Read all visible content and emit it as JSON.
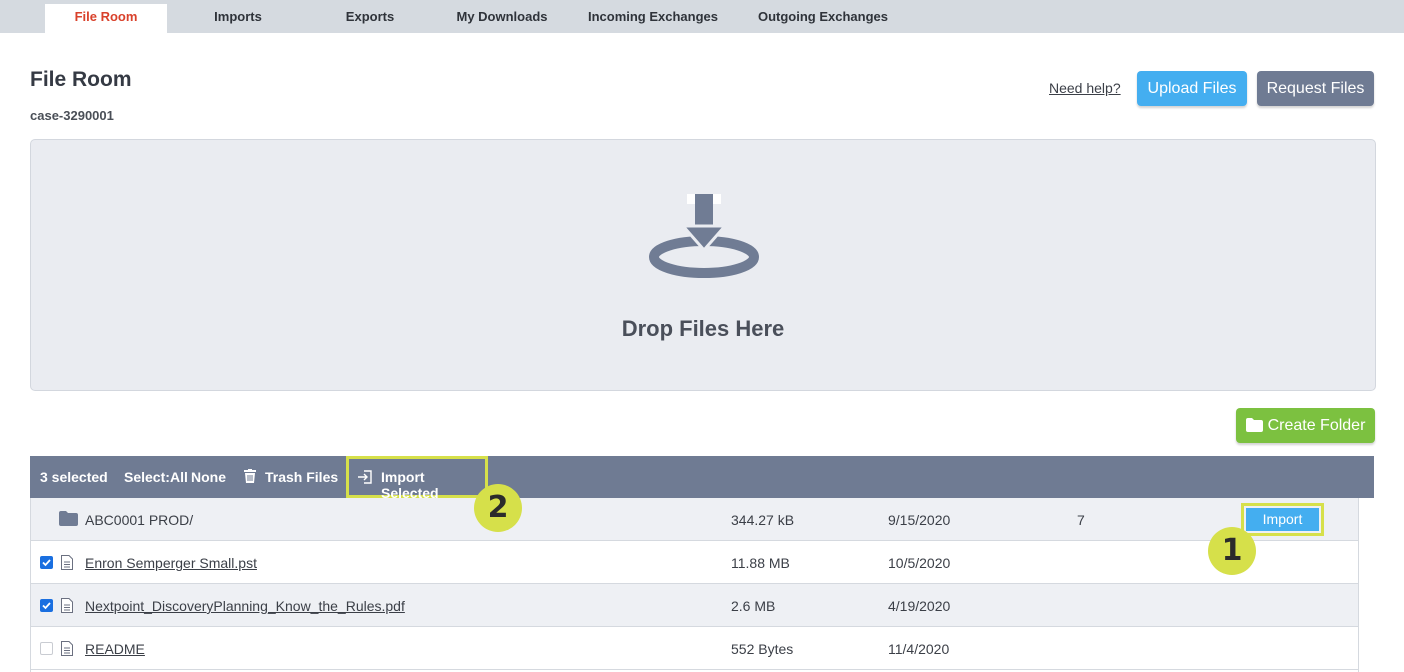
{
  "tabs": [
    {
      "label": "File Room",
      "active": true
    },
    {
      "label": "Imports",
      "active": false
    },
    {
      "label": "Exports",
      "active": false
    },
    {
      "label": "My Downloads",
      "active": false
    },
    {
      "label": "Incoming Exchanges",
      "active": false
    },
    {
      "label": "Outgoing Exchanges",
      "active": false
    }
  ],
  "header": {
    "title": "File Room",
    "case_id": "case-3290001",
    "help_link": "Need help?",
    "upload_label": "Upload Files",
    "request_label": "Request Files"
  },
  "dropzone": {
    "text": "Drop Files Here",
    "icon": "download-tray-icon"
  },
  "create_folder_label": "Create Folder",
  "toolbar": {
    "selected_text": "3 selected",
    "select_label": "Select:",
    "select_all": "All",
    "select_none": "None",
    "trash_label": "Trash Files",
    "import_selected_label": "Import Selected"
  },
  "rows": [
    {
      "type": "folder",
      "name": "ABC0001 PROD/",
      "size": "344.27 kB",
      "date": "9/15/2020",
      "count": "7",
      "action": "Import",
      "checked": null
    },
    {
      "type": "file",
      "name": "Enron Semperger Small.pst",
      "size": "11.88 MB",
      "date": "10/5/2020",
      "checked": true
    },
    {
      "type": "file",
      "name": "Nextpoint_DiscoveryPlanning_Know_the_Rules.pdf",
      "size": "2.6 MB",
      "date": "4/19/2020",
      "checked": true
    },
    {
      "type": "file",
      "name": "README",
      "size": "552 Bytes",
      "date": "11/4/2020",
      "checked": false
    }
  ],
  "callouts": [
    "1",
    "2"
  ],
  "colors": {
    "tab_bar": "#d5dae0",
    "active_tab_text": "#d9412b",
    "primary_blue": "#44aef0",
    "slate": "#6f7b93",
    "green": "#7cc140",
    "highlight": "#d6e04a",
    "checkbox": "#1a6fe0"
  }
}
